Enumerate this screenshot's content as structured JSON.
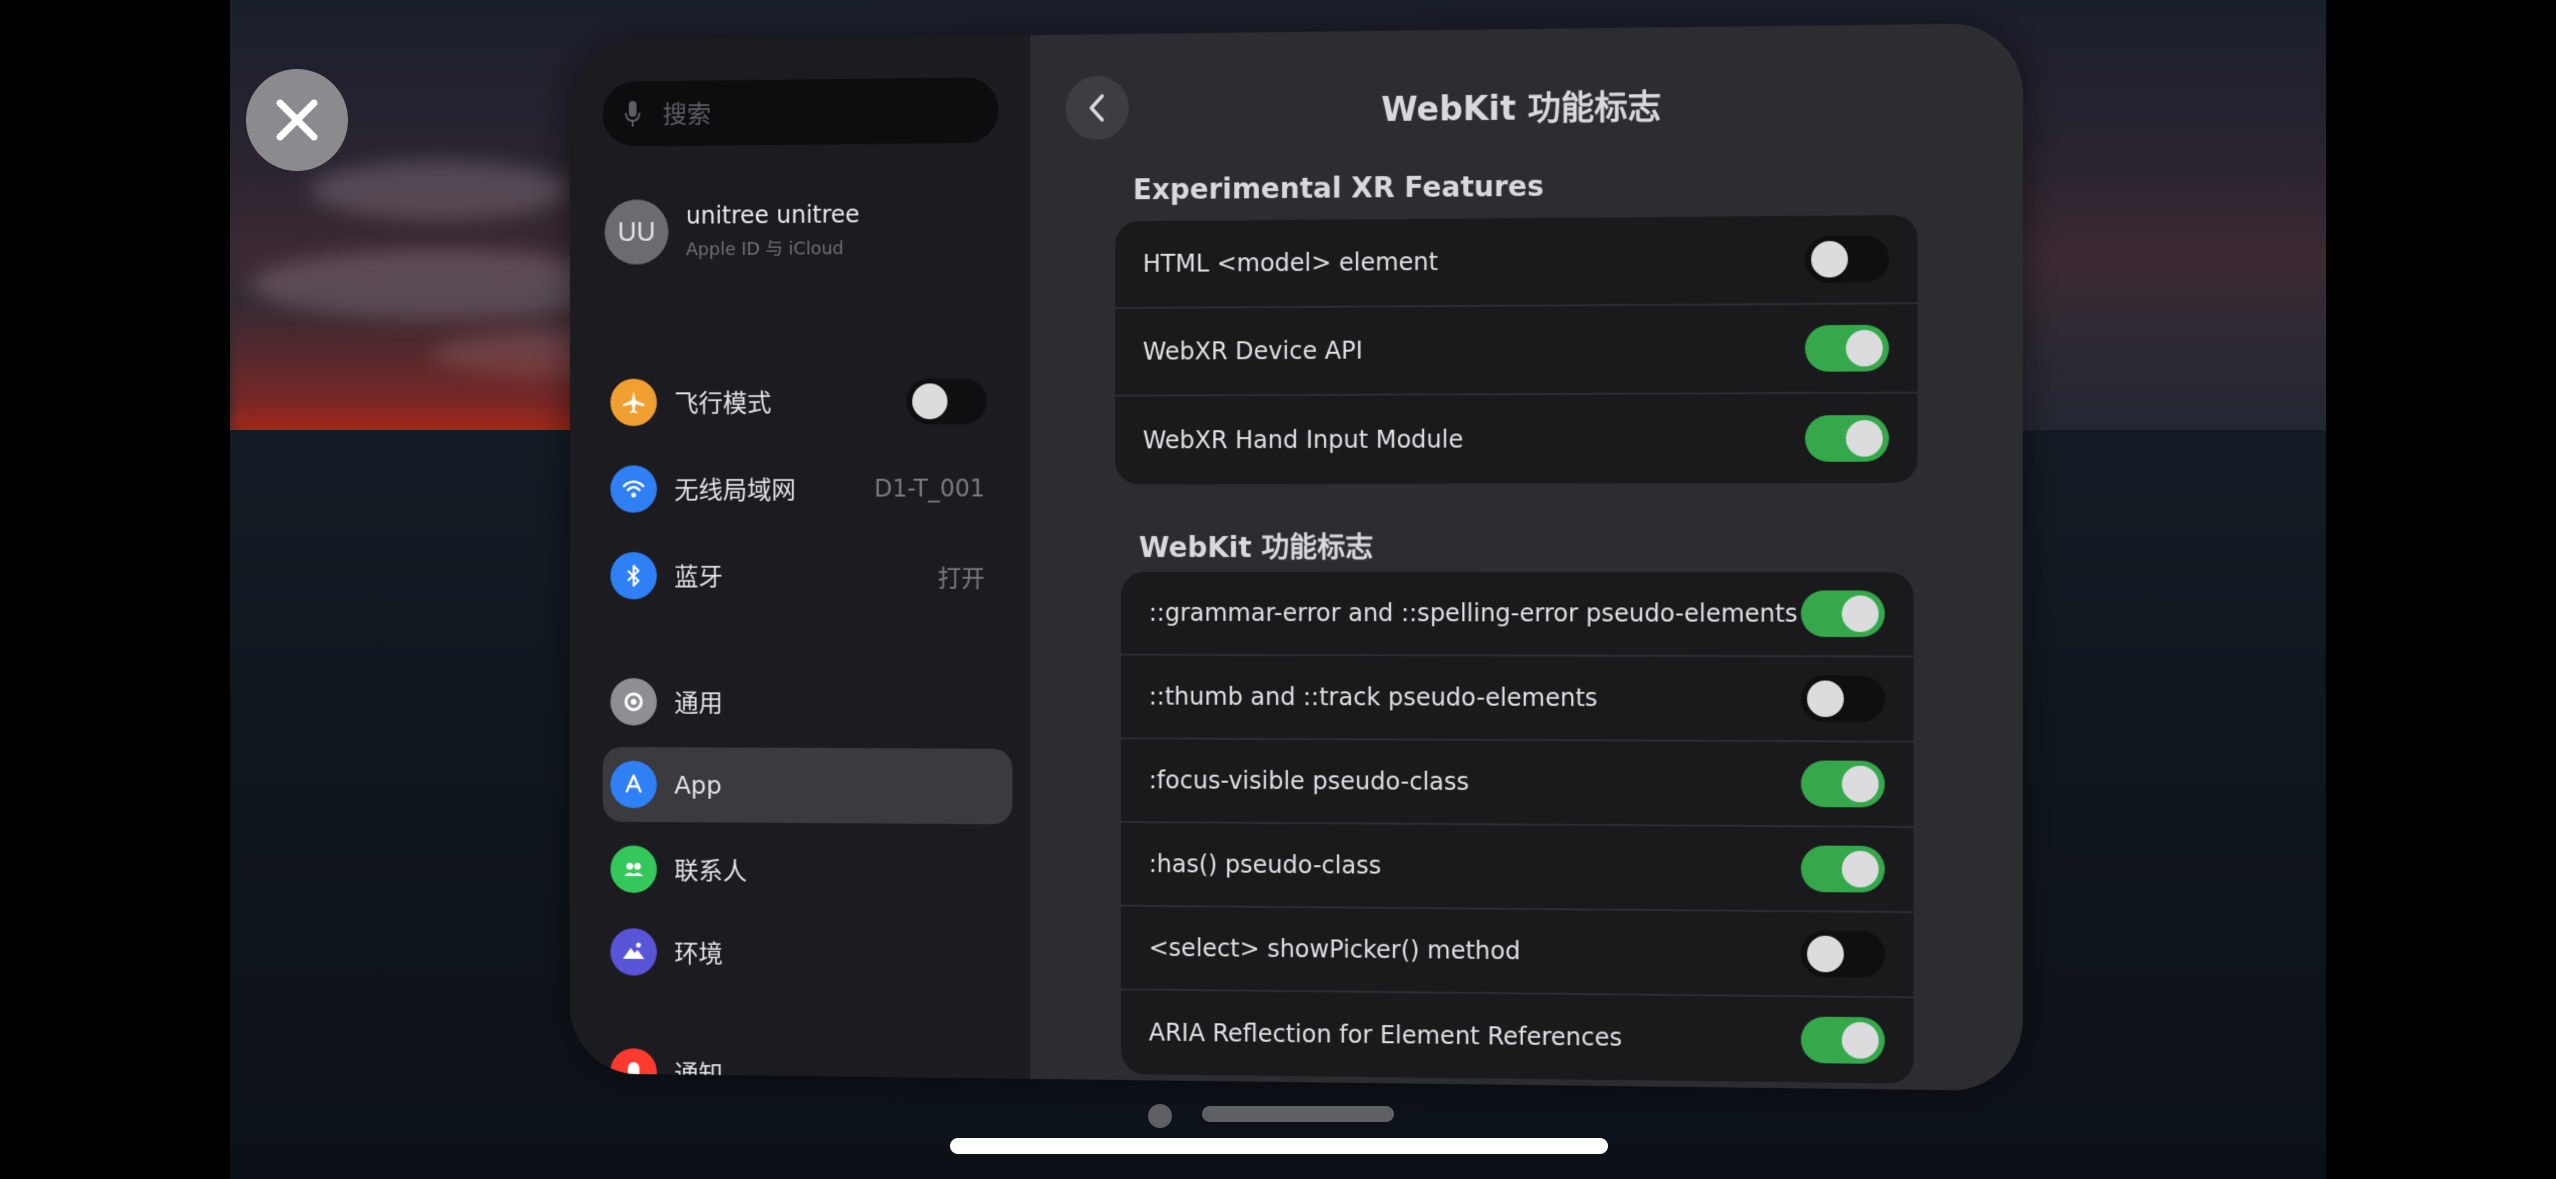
{
  "sidebar": {
    "search_placeholder": "搜索",
    "profile": {
      "initials": "UU",
      "name": "unitree unitree",
      "subtitle": "Apple ID 与 iCloud"
    },
    "items": [
      {
        "label": "飞行模式",
        "icon": "airplane-icon",
        "color": "#f0a030",
        "toggle": "off"
      },
      {
        "label": "无线局域网",
        "icon": "wifi-icon",
        "color": "#2f7ff5",
        "value": "D1-T_001"
      },
      {
        "label": "蓝牙",
        "icon": "bluetooth-icon",
        "color": "#2f7ff5",
        "value": "打开"
      },
      {
        "label": "通用",
        "icon": "gear-icon",
        "color": "#8e8e93"
      },
      {
        "label": "App",
        "icon": "app-store-icon",
        "color": "#2f7ff5",
        "selected": true
      },
      {
        "label": "联系人",
        "icon": "contacts-icon",
        "color": "#34c759"
      },
      {
        "label": "环境",
        "icon": "environment-icon",
        "color": "#5856d6"
      },
      {
        "label": "通知",
        "icon": "notification-icon",
        "color": "#ff3b30"
      }
    ]
  },
  "content": {
    "title": "WebKit 功能标志",
    "sections": [
      {
        "title": "Experimental XR Features",
        "rows": [
          {
            "label": "HTML <model> element",
            "on": false
          },
          {
            "label": "WebXR Device API",
            "on": true
          },
          {
            "label": "WebXR Hand Input Module",
            "on": true
          }
        ]
      },
      {
        "title": "WebKit 功能标志",
        "rows": [
          {
            "label": "::grammar-error and ::spelling-error pseudo-elements",
            "on": true
          },
          {
            "label": "::thumb and ::track pseudo-elements",
            "on": false
          },
          {
            "label": ":focus-visible pseudo-class",
            "on": true
          },
          {
            "label": ":has() pseudo-class",
            "on": true
          },
          {
            "label": "<select> showPicker() method",
            "on": false
          },
          {
            "label": "ARIA Reflection for Element References",
            "on": true
          }
        ]
      }
    ]
  },
  "colors": {
    "toggle_on": "#34a84a",
    "toggle_off": "#0f0f11"
  }
}
